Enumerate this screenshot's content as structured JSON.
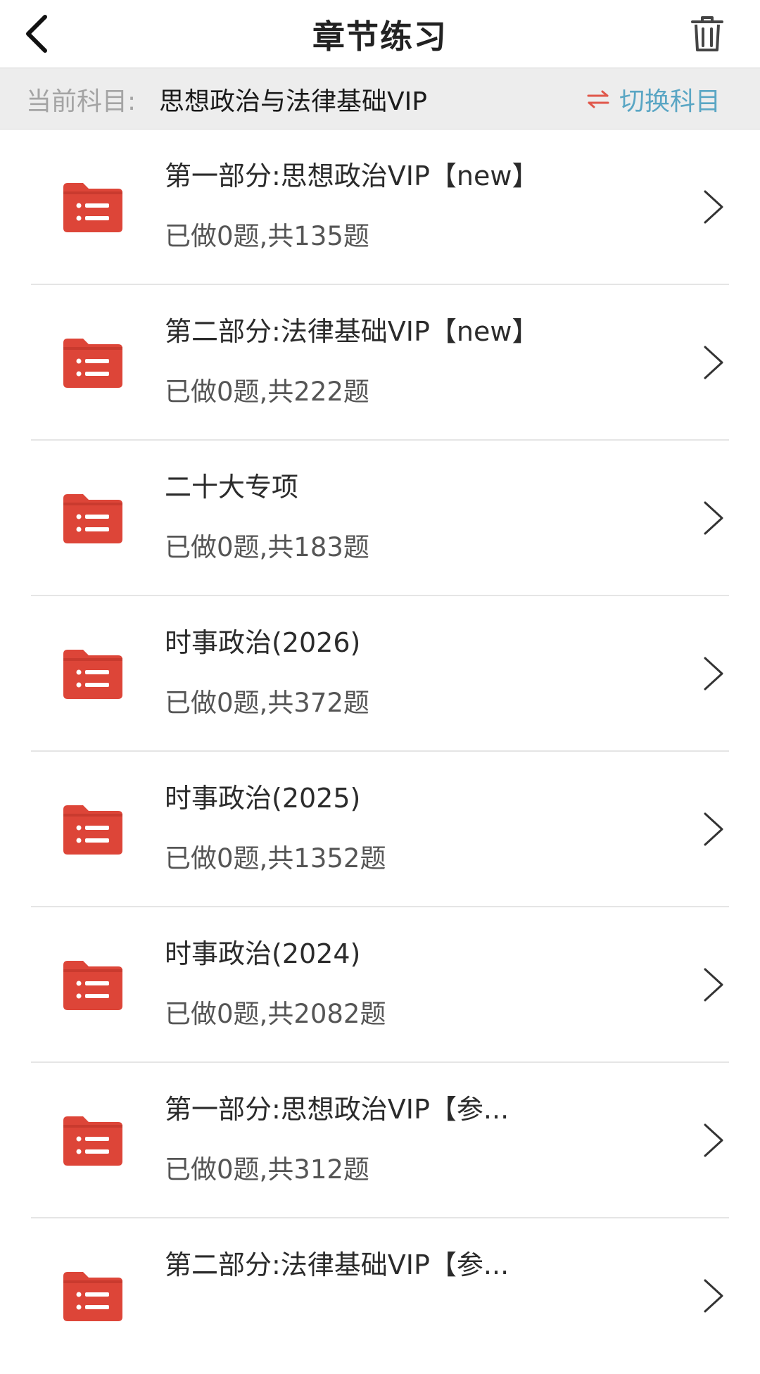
{
  "header": {
    "title": "章节练习",
    "back_icon": "chevron-left-icon",
    "trash_icon": "trash-icon"
  },
  "subject_bar": {
    "label": "当前科目:",
    "subject": "思想政治与法律基础VIP",
    "switch_label": "切换科目",
    "switch_icon": "swap-arrows-icon"
  },
  "colors": {
    "folder_red": "#dd4538",
    "switch_blue": "#5aa6c4",
    "switch_arrows_red": "#e0574a"
  },
  "items": [
    {
      "title": "第一部分:思想政治VIP【new】",
      "progress": "已做0题,共135题"
    },
    {
      "title": "第二部分:法律基础VIP【new】",
      "progress": "已做0题,共222题"
    },
    {
      "title": "二十大专项",
      "progress": "已做0题,共183题"
    },
    {
      "title": "时事政治(2026)",
      "progress": "已做0题,共372题"
    },
    {
      "title": "时事政治(2025)",
      "progress": "已做0题,共1352题"
    },
    {
      "title": "时事政治(2024)",
      "progress": "已做0题,共2082题"
    },
    {
      "title": "第一部分:思想政治VIP【参...",
      "progress": "已做0题,共312题"
    },
    {
      "title": "第二部分:法律基础VIP【参...",
      "progress": ""
    }
  ]
}
